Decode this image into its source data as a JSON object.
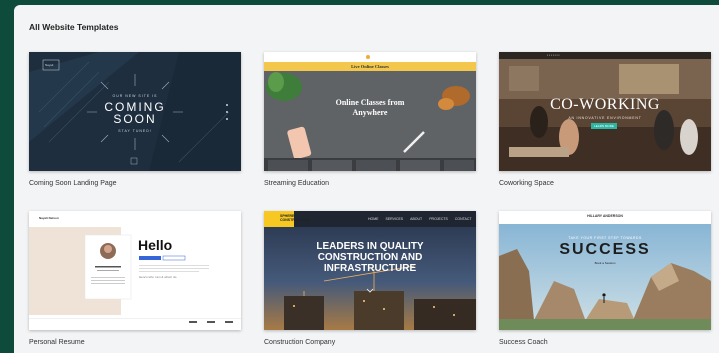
{
  "heading": "All Website Templates",
  "templates": [
    {
      "caption": "Coming Soon Landing Page",
      "preview": {
        "logo": "Nayeli",
        "eyebrow": "OUR NEW SITE IS",
        "title_line1": "COMING",
        "title_line2": "SOON",
        "subtitle": "STAY TUNED!"
      }
    },
    {
      "caption": "Streaming Education",
      "preview": {
        "banner": "Live Online Classes",
        "headline_line1": "Online Classes from",
        "headline_line2": "Anywhere"
      }
    },
    {
      "caption": "Coworking Space",
      "preview": {
        "headline": "CO-WORKING",
        "tagline": "AN INNOVATIVE ENVIRONMENT",
        "cta": "LEARN MORE"
      }
    },
    {
      "caption": "Personal Resume",
      "preview": {
        "greeting": "Hello",
        "name": "Nayeli Nelson",
        "tagline": "Here's who I am & what I do"
      }
    },
    {
      "caption": "Construction Company",
      "preview": {
        "logo": "SPHERE CONSTRUCTIONS",
        "nav": [
          "HOME",
          "SERVICES",
          "ABOUT",
          "PROJECTS",
          "CONTACT"
        ],
        "headline_line1": "LEADERS IN QUALITY",
        "headline_line2": "CONSTRUCTION AND",
        "headline_line3": "INFRASTRUCTURE"
      }
    },
    {
      "caption": "Success Coach",
      "preview": {
        "logo": "HILLARY ANDERSON",
        "eyebrow": "TAKE YOUR FIRST STEP TOWARDS",
        "headline": "SUCCESS",
        "cta": "Book a Session"
      }
    }
  ],
  "colors": {
    "frame": "#0f4b3a",
    "panel": "#f3f4f6",
    "cowork_cta": "#2bb5a2",
    "construction_logo": "#f6c821",
    "streaming_banner": "#f2c74b"
  }
}
